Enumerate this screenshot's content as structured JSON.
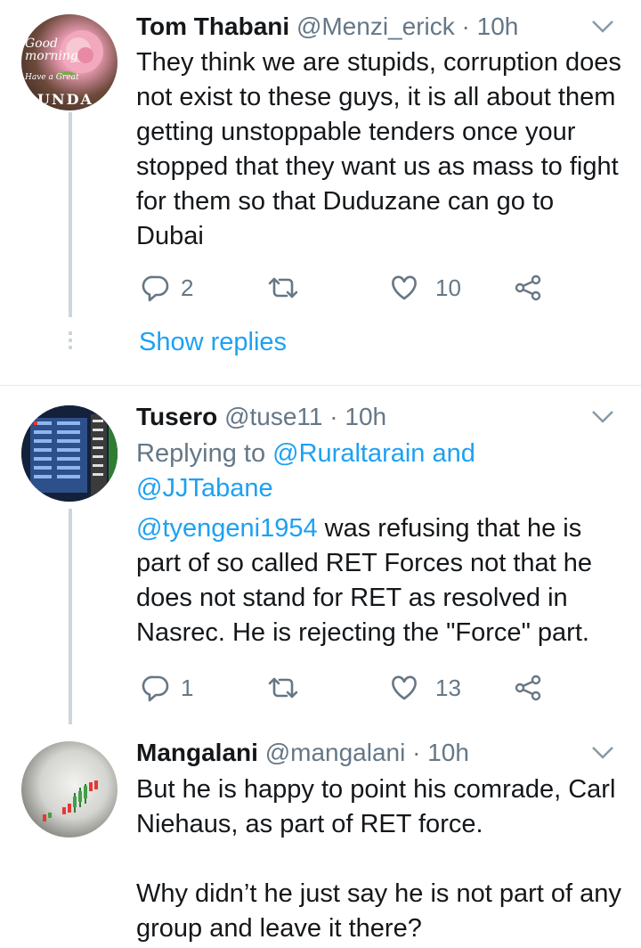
{
  "tweets": [
    {
      "name": "Tom Thabani",
      "handle": "@Menzi_erick",
      "separator": "·",
      "time": "10h",
      "avatar_text": {
        "line1": "Good",
        "line2": "morning",
        "line3": "Have a Great",
        "line4": "UNDA"
      },
      "body": "They think we are stupids, corruption does not exist to these guys, it is all about them getting unstoppable tenders once your stopped that they want us as mass to fight for them so that Duduzane can go to Dubai",
      "replies": "2",
      "retweets": "",
      "likes": "10",
      "show_replies": "Show replies"
    },
    {
      "name": "Tusero",
      "handle": "@tuse11",
      "separator": "·",
      "time": "10h",
      "reply_label": "Replying to",
      "reply_to_1": "@Ruraltarain",
      "reply_and": "and",
      "reply_to_2": "@JJTabane",
      "body_mention": "@tyengeni1954",
      "body_rest": " was refusing that he is part of so called RET Forces not that he does not stand for RET as resolved in Nasrec. He is rejecting the \"Force\" part.",
      "replies": "1",
      "retweets": "",
      "likes": "13"
    },
    {
      "name": "Mangalani",
      "handle": "@mangalani",
      "separator": "·",
      "time": "10h",
      "body_p1": "But he is happy to point his comrade, Carl Niehaus, as part of RET force.",
      "body_p2": "Why didn’t he just say he is not part of any group and leave it there?"
    }
  ],
  "colors": {
    "link": "#1da1f2",
    "muted": "#657786",
    "divider": "#e1e8ed"
  },
  "icons": [
    "reply-icon",
    "retweet-icon",
    "like-icon",
    "share-icon",
    "chevron-down-icon"
  ]
}
